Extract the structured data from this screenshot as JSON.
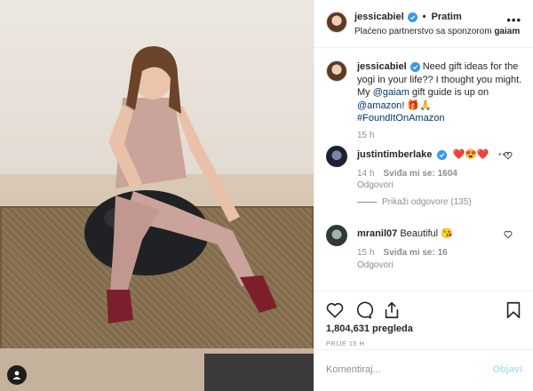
{
  "post": {
    "author": "jessicabiel",
    "follow_label": "Pratim",
    "sponsor_prefix": "Plaćeno partnerstvo sa sponzorom",
    "sponsor": "gaiam",
    "more_label": "•••"
  },
  "caption": {
    "user": "jessicabiel",
    "text_1": " Need gift ideas for the yogi in your life?? I thought you might. My ",
    "mention_1": "@gaiam",
    "text_2": " gift guide is up on ",
    "mention_2": "@amazon",
    "text_3": "! 🎁🙏",
    "hashtag": "#FoundItOnAmazon",
    "time": "15 h"
  },
  "comments": [
    {
      "user": "justintimberlake",
      "text": "❤️😍❤️",
      "time": "14 h",
      "likes": "Sviđa mi se: 1604",
      "reply_label": "Odgovori",
      "view_replies": "Prikaži odgovore (135)",
      "more_label": "•••"
    },
    {
      "user": "mranil07",
      "text": "Beautiful 😘",
      "time": "15 h",
      "likes": "Sviđa mi se: 16",
      "reply_label": "Odgovori"
    }
  ],
  "stats": {
    "views": "1,804,631 pregleda",
    "ago": "PRIJE 15 H"
  },
  "compose": {
    "placeholder": "Komentiraj...",
    "post_label": "Objavi"
  },
  "colors": {
    "link": "#003569",
    "verified": "#3897f0",
    "muted": "#8e8e8e",
    "post_disabled": "#b2dffc"
  },
  "icons": [
    "verified-badge-icon",
    "heart-icon",
    "comment-icon",
    "share-icon",
    "bookmark-icon",
    "profile-tag-icon"
  ]
}
